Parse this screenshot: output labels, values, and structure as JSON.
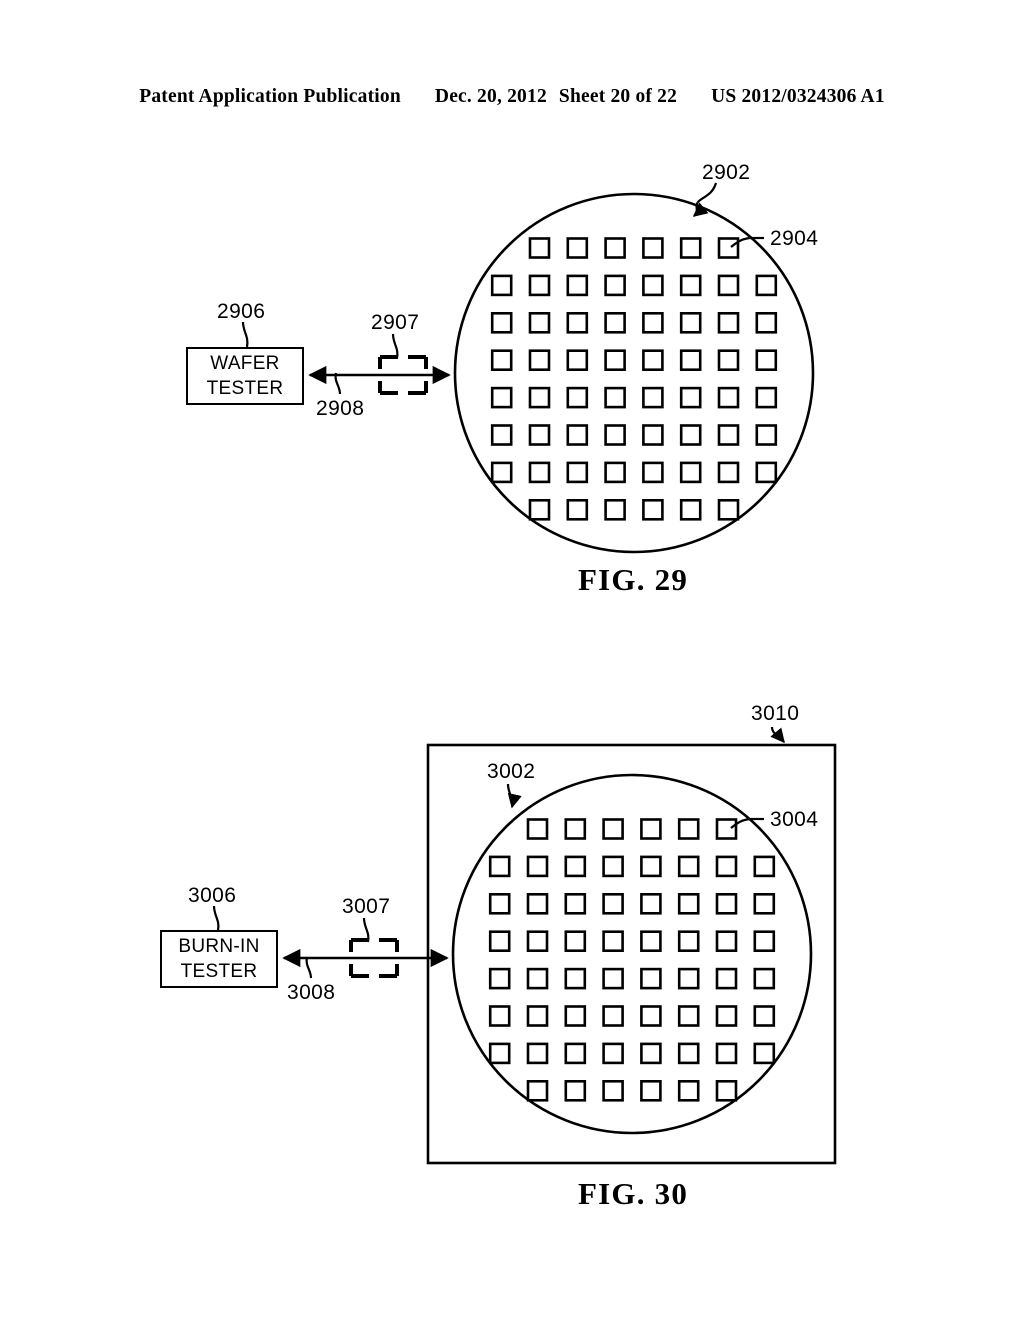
{
  "header": {
    "publication": "Patent Application Publication",
    "date": "Dec. 20, 2012",
    "sheet": "Sheet 20 of 22",
    "docnum": "US 2012/0324306 A1"
  },
  "figures": [
    {
      "caption": "FIG. 29",
      "tester": {
        "line1": "WAFER",
        "line2": "TESTER",
        "ref": "2906"
      },
      "link_ref": "2908",
      "interface_ref": "2907",
      "wafer_ref": "2902",
      "die_ref": "2904",
      "die_grid": {
        "rows": 8,
        "counts_per_row": [
          6,
          8,
          8,
          8,
          8,
          8,
          8,
          6
        ]
      }
    },
    {
      "caption": "FIG. 30",
      "tester": {
        "line1": "BURN-IN",
        "line2": "TESTER",
        "ref": "3006"
      },
      "link_ref": "3008",
      "interface_ref": "3007",
      "wafer_ref": "3002",
      "die_ref": "3004",
      "chamber_ref": "3010",
      "die_grid": {
        "rows": 8,
        "counts_per_row": [
          6,
          8,
          8,
          8,
          8,
          8,
          8,
          6
        ]
      }
    }
  ],
  "colors": {
    "ink": "#000000",
    "paper": "#ffffff"
  }
}
